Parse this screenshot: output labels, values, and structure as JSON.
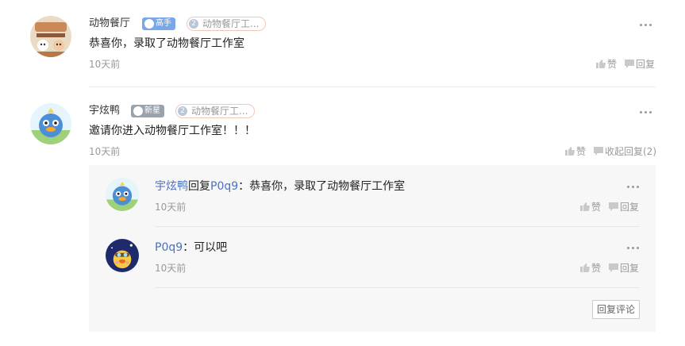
{
  "comments": [
    {
      "username": "动物餐厅",
      "badge": "高手",
      "medal_num": "2",
      "medal": "动物餐厅工...",
      "text": "恭喜你，录取了动物餐厅工作室",
      "time": "10天前",
      "like_label": "赞",
      "reply_label": "回复"
    },
    {
      "username": "宇炫鸭",
      "badge": "新星",
      "medal_num": "2",
      "medal": "动物餐厅工...",
      "text": "邀请你进入动物餐厅工作室！！！",
      "time": "10天前",
      "like_label": "赞",
      "reply_label": "收起回复(2)"
    }
  ],
  "replies": [
    {
      "username": "宇炫鸭",
      "reply_word": "回复",
      "target": "P0q9",
      "text": "：恭喜你，录取了动物餐厅工作室",
      "time": "10天前",
      "like_label": "赞",
      "reply_label": "回复"
    },
    {
      "username": "P0q9",
      "text": "：可以吧",
      "time": "10天前",
      "like_label": "赞",
      "reply_label": "回复"
    }
  ],
  "reply_comment_button": "回复评论",
  "colors": {
    "link": "#4a72c2",
    "badge_gaoshou": "#7aa8e6",
    "badge_xinxing": "#9aa3ad",
    "reply_bg": "#f7f7f7"
  },
  "icons": {
    "more": "more-dots-icon",
    "like": "thumb-up-icon",
    "reply": "speech-bubble-icon"
  }
}
